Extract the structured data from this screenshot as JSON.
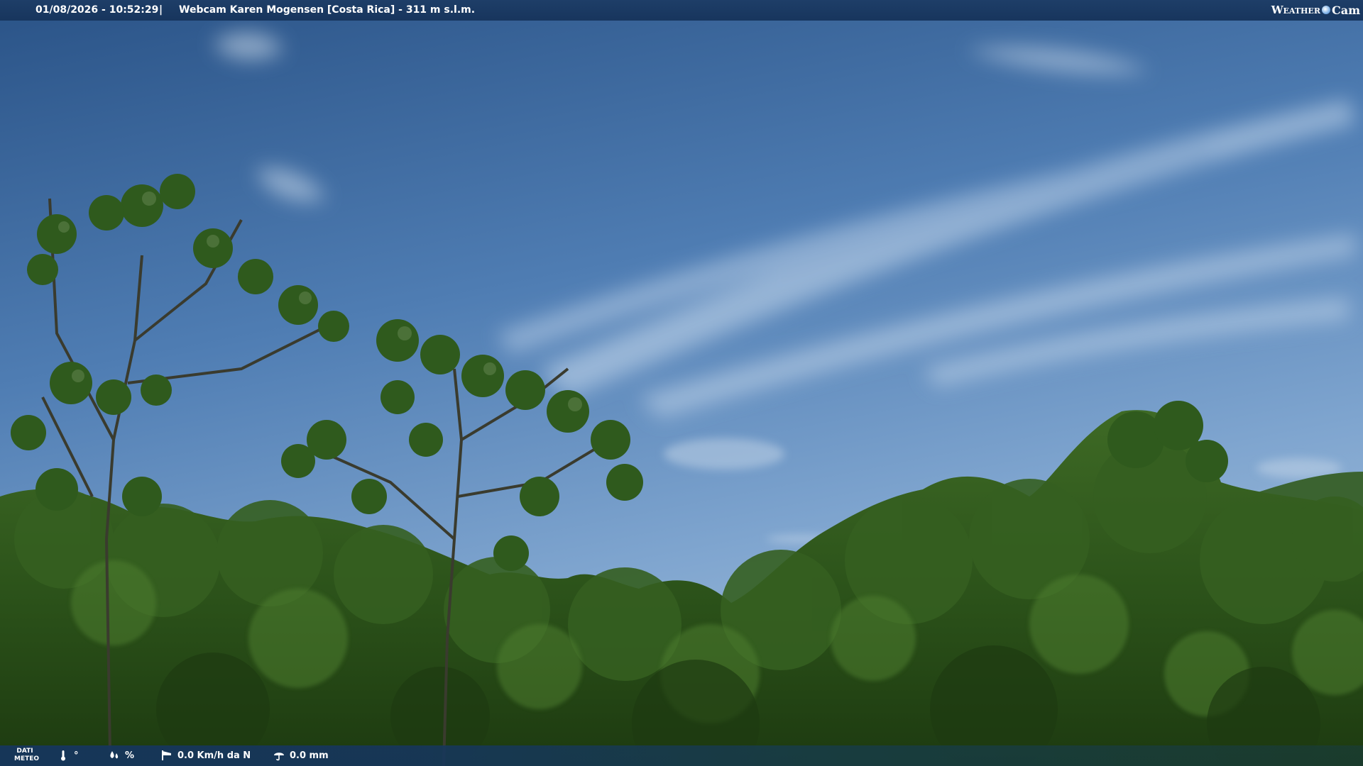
{
  "header": {
    "datetime": "01/08/2026 - 10:52:29",
    "separator": "|",
    "title": "Webcam Karen Mogensen [Costa Rica] - 311 m s.l.m."
  },
  "logo": {
    "part1": "Weather",
    "part2": "Cam"
  },
  "weather_bar": {
    "dati_line1": "DATI",
    "dati_line2": "METEO",
    "temperature": "°",
    "humidity": "%",
    "wind": "0.0 Km/h da N",
    "rain": "0.0 mm"
  },
  "colors": {
    "bar": "#17355d",
    "sky_top": "#2b5489",
    "sky_bottom": "#7aa3cf",
    "foliage": "#2f5a1c"
  }
}
